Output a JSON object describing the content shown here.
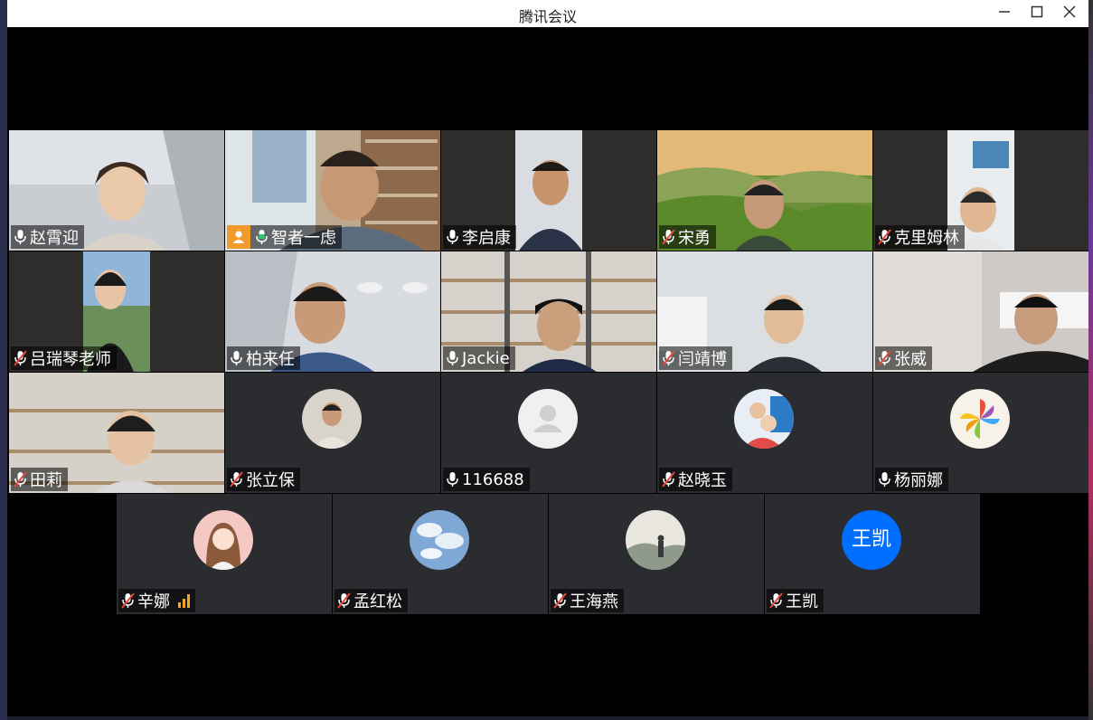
{
  "window": {
    "title": "腾讯会议",
    "minimize_icon": "minimize-icon",
    "maximize_icon": "maximize-icon",
    "close_icon": "close-icon"
  },
  "participants": [
    {
      "name": "赵霄迎",
      "mic": "on",
      "video": "on"
    },
    {
      "name": "智者一虑",
      "mic": "on",
      "video": "on",
      "host": true,
      "speaking": true
    },
    {
      "name": "李启康",
      "mic": "on",
      "video": "on"
    },
    {
      "name": "宋勇",
      "mic": "muted",
      "video": "on"
    },
    {
      "name": "克里姆林",
      "mic": "muted",
      "video": "on"
    },
    {
      "name": "吕瑞琴老师",
      "mic": "muted",
      "video": "on"
    },
    {
      "name": "柏来任",
      "mic": "on",
      "video": "on"
    },
    {
      "name": "Jackie",
      "mic": "on",
      "video": "on"
    },
    {
      "name": "闫靖博",
      "mic": "muted",
      "video": "on"
    },
    {
      "name": "张威",
      "mic": "muted",
      "video": "on"
    },
    {
      "name": "田莉",
      "mic": "muted",
      "video": "on"
    },
    {
      "name": "张立保",
      "mic": "muted",
      "video": "off"
    },
    {
      "name": "116688",
      "mic": "on",
      "video": "off"
    },
    {
      "name": "赵晓玉",
      "mic": "muted",
      "video": "off"
    },
    {
      "name": "杨丽娜",
      "mic": "on",
      "video": "off"
    },
    {
      "name": "辛娜",
      "mic": "muted",
      "video": "off",
      "signal": "weak"
    },
    {
      "name": "孟红松",
      "mic": "muted",
      "video": "off"
    },
    {
      "name": "王海燕",
      "mic": "muted",
      "video": "off"
    },
    {
      "name": "王凯",
      "mic": "muted",
      "video": "off",
      "avatar_text": "王凯"
    }
  ],
  "colors": {
    "speaking_border": "#2ecc71",
    "host_badge": "#f19b2c",
    "avatar_blue": "#006fff",
    "muted_red": "#e8473b",
    "signal": "#f5a623"
  }
}
